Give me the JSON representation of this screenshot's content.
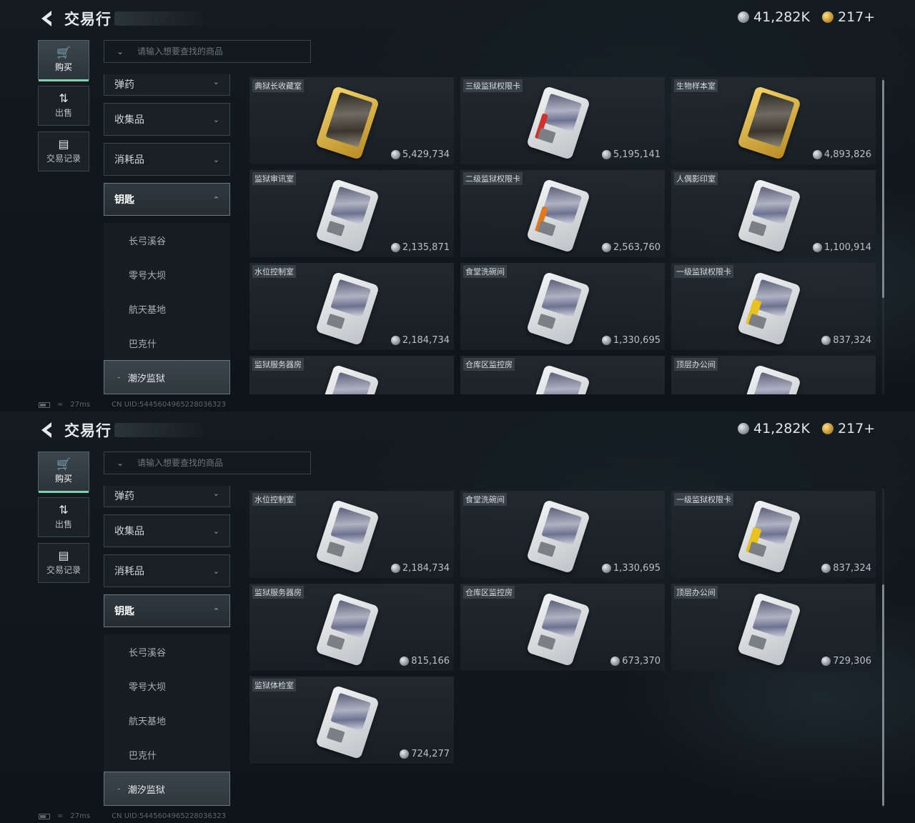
{
  "header": {
    "title": "交易行",
    "currency_silver": "41,282K",
    "currency_gold": "217+"
  },
  "nav": {
    "buy": "购买",
    "sell": "出售",
    "records": "交易记录"
  },
  "search": {
    "placeholder": "请输入想要查找的商品"
  },
  "categories": {
    "ammo": "弹药",
    "collectibles": "收集品",
    "consumables": "消耗品",
    "keys": "钥匙",
    "sub": [
      "长弓溪谷",
      "零号大坝",
      "航天基地",
      "巴克什",
      "潮汐监狱"
    ]
  },
  "status": {
    "ping": "27ms",
    "uid": "CN UID:5445604965228036323"
  },
  "items": [
    {
      "name": "典狱长收藏室",
      "price": "5,429,734",
      "style": "gold"
    },
    {
      "name": "三级监狱权限卡",
      "price": "5,195,141",
      "style": "red"
    },
    {
      "name": "生物样本室",
      "price": "4,893,826",
      "style": "gold"
    },
    {
      "name": "监狱审讯室",
      "price": "2,135,871",
      "style": "silver"
    },
    {
      "name": "二级监狱权限卡",
      "price": "2,563,760",
      "style": "orange"
    },
    {
      "name": "人偶影印室",
      "price": "1,100,914",
      "style": "silver"
    },
    {
      "name": "水位控制室",
      "price": "2,184,734",
      "style": "silver"
    },
    {
      "name": "食堂洗碗间",
      "price": "1,330,695",
      "style": "silver"
    },
    {
      "name": "一级监狱权限卡",
      "price": "837,324",
      "style": "yellow"
    },
    {
      "name": "监狱服务器房",
      "price": "815,166",
      "style": "silver"
    },
    {
      "name": "仓库区监控房",
      "price": "673,370",
      "style": "silver"
    },
    {
      "name": "顶层办公间",
      "price": "729,306",
      "style": "silver"
    },
    {
      "name": "监狱体检室",
      "price": "724,277",
      "style": "silver"
    }
  ],
  "colors": {
    "accent": "#7fd2b0",
    "card_bg": "#232b31",
    "gold_card": "#d9b24a",
    "stripe_red": "#d2312a",
    "stripe_orange": "#e07a1c",
    "stripe_yellow": "#e9c21f"
  },
  "icons": {
    "back": "back-arrow-icon",
    "buy": "cart-icon",
    "sell": "sell-exchange-icon",
    "records": "document-icon",
    "price": "coin-icon"
  }
}
